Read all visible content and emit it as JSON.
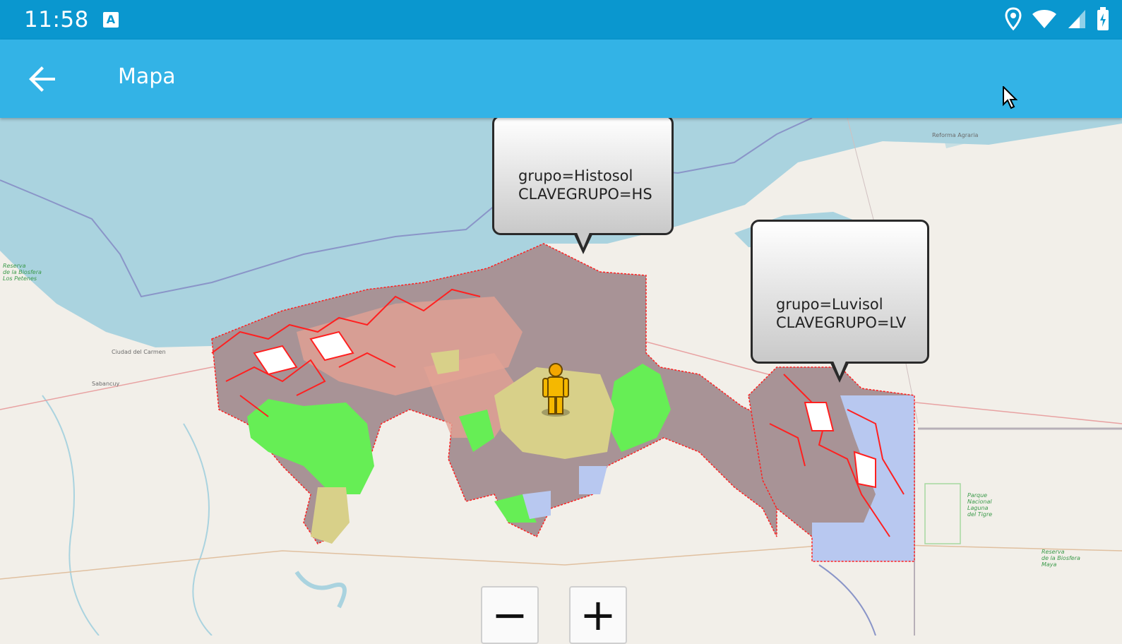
{
  "status_bar": {
    "time": "11:58",
    "notification_icon": "a-icon",
    "icons": [
      "location-icon",
      "wifi-icon",
      "signal-icon",
      "battery-icon"
    ],
    "color": "#0a97cf"
  },
  "app_bar": {
    "title": "Mapa",
    "back_icon": "arrow-back-icon",
    "color": "#33b3e6"
  },
  "map": {
    "popups": [
      {
        "line1": "grupo=Histosol",
        "line2": "CLAVEGRUPO=HS"
      },
      {
        "line1": "grupo=Luvisol",
        "line2": "CLAVEGRUPO=LV"
      }
    ],
    "marker_icon": "person-marker-icon",
    "zoom_out_label": "−",
    "zoom_in_label": "+",
    "colors": {
      "water": "#aad3df",
      "land": "#f2efe9",
      "soil_gray": "#a89396",
      "soil_green": "#66ee55",
      "soil_tan": "#d8d089",
      "soil_blue": "#b8c8f0",
      "outline_red": "#ff2020"
    }
  }
}
